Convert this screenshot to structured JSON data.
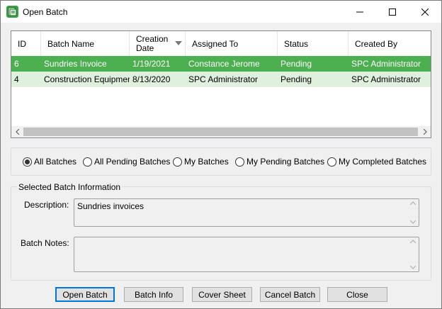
{
  "window": {
    "title": "Open Batch",
    "accent_color": "#4caf50",
    "icon": "batch-app-icon"
  },
  "grid": {
    "columns": [
      {
        "label": "ID"
      },
      {
        "label": "Batch Name"
      },
      {
        "label": "Creation Date",
        "line1": "Creation",
        "line2": "Date",
        "sorted": "descending"
      },
      {
        "label": "Assigned To"
      },
      {
        "label": "Status"
      },
      {
        "label": "Created By"
      }
    ],
    "rows": [
      {
        "id": "6",
        "batch_name": "Sundries Invoice",
        "creation_date": "1/19/2021",
        "assigned_to": "Constance Jerome",
        "status": "Pending",
        "created_by": "SPC Administrator",
        "selected": true
      },
      {
        "id": "4",
        "batch_name": "Construction Equipmen...",
        "creation_date": "8/13/2020",
        "assigned_to": "SPC Administrator",
        "status": "Pending",
        "created_by": "SPC Administrator",
        "selected": false
      }
    ]
  },
  "filters": {
    "options": [
      {
        "label": "All Batches",
        "checked": true
      },
      {
        "label": "All Pending Batches",
        "checked": false
      },
      {
        "label": "My Batches",
        "checked": false
      },
      {
        "label": "My Pending Batches",
        "checked": false
      },
      {
        "label": "My Completed Batches",
        "checked": false
      }
    ]
  },
  "selected_info": {
    "group_label": "Selected Batch Information",
    "description_label": "Description:",
    "description_value": "Sundries invoices",
    "notes_label": "Batch Notes:",
    "notes_value": ""
  },
  "buttons": {
    "open": "Open Batch",
    "info": "Batch Info",
    "cover": "Cover Sheet",
    "cancel": "Cancel Batch",
    "close": "Close"
  }
}
